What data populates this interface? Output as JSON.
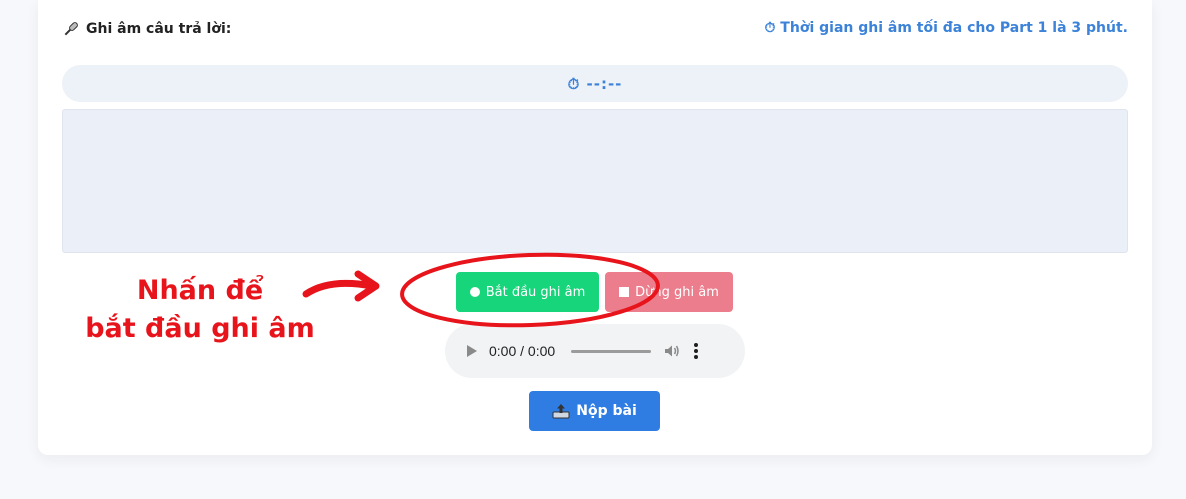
{
  "header": {
    "record_label": "Ghi âm câu trả lời:",
    "time_limit": "⏱ Thời gian ghi âm tối đa cho Part 1 là 3 phút."
  },
  "timer": {
    "icon": "stopwatch-icon",
    "value": "⏱ --:--"
  },
  "controls": {
    "start_label": "Bắt đầu ghi âm",
    "stop_label": "Dừng ghi âm",
    "start_color": "#17d57a",
    "stop_color": "#ec7d8c"
  },
  "audio": {
    "time": "0:00 / 0:00"
  },
  "submit": {
    "label": "Nộp bài",
    "color": "#2f7de3"
  },
  "annotation": {
    "line1": "Nhấn để",
    "line2": "bắt đầu ghi âm",
    "color": "#e8141b"
  }
}
